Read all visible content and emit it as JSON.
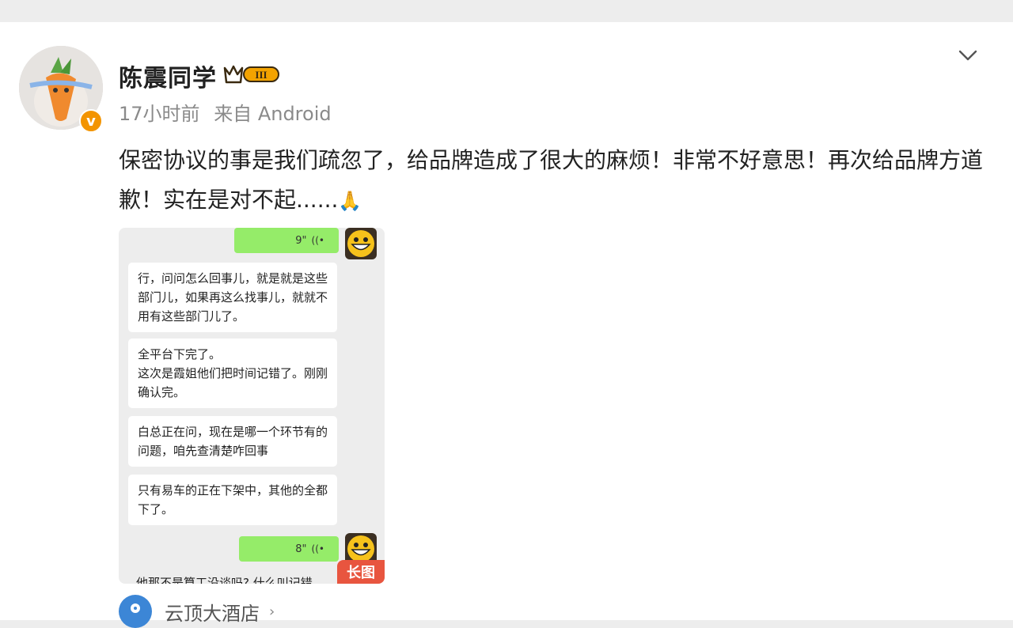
{
  "post": {
    "username": "陈震同学",
    "vip_level": "III",
    "verified_mark": "v",
    "time": "17小时前",
    "source": "来自 Android",
    "text": "保密协议的事是我们疏忽了，给品牌造成了很大的麻烦！非常不好意思！再次给品牌方道歉！实在是对不起......",
    "emoji": "🙏"
  },
  "image": {
    "voice_top": {
      "duration": "9\""
    },
    "messages": [
      "行，问问怎么回事儿，就是就是这些部门儿，如果再这么找事儿，就就不用有这些部门儿了。",
      "全平台下完了。\n这次是霞姐他们把时间记错了。刚刚确认完。",
      "白总正在问，现在是哪一个环节有的问题，咱先查清楚咋回事",
      "只有易车的正在下架中，其他的全都下了。"
    ],
    "voice_bottom": {
      "duration": "8\""
    },
    "cut_text": "他那不是算工没谈吗? 什么叫记错",
    "badge": "长图"
  },
  "location": {
    "name": "云顶大酒店",
    "arrow": "›"
  },
  "colors": {
    "voice_green": "#95ec69",
    "badge_red": "#e8553f",
    "vip_gold": "#f3a300",
    "location_blue": "#3c86d6"
  },
  "icons": [
    "avatar",
    "verified-badge-icon",
    "vip-crown-icon",
    "chevron-down-icon",
    "pray-emoji",
    "voice-wave-icon",
    "smile-avatar-icon",
    "location-pin-icon"
  ]
}
